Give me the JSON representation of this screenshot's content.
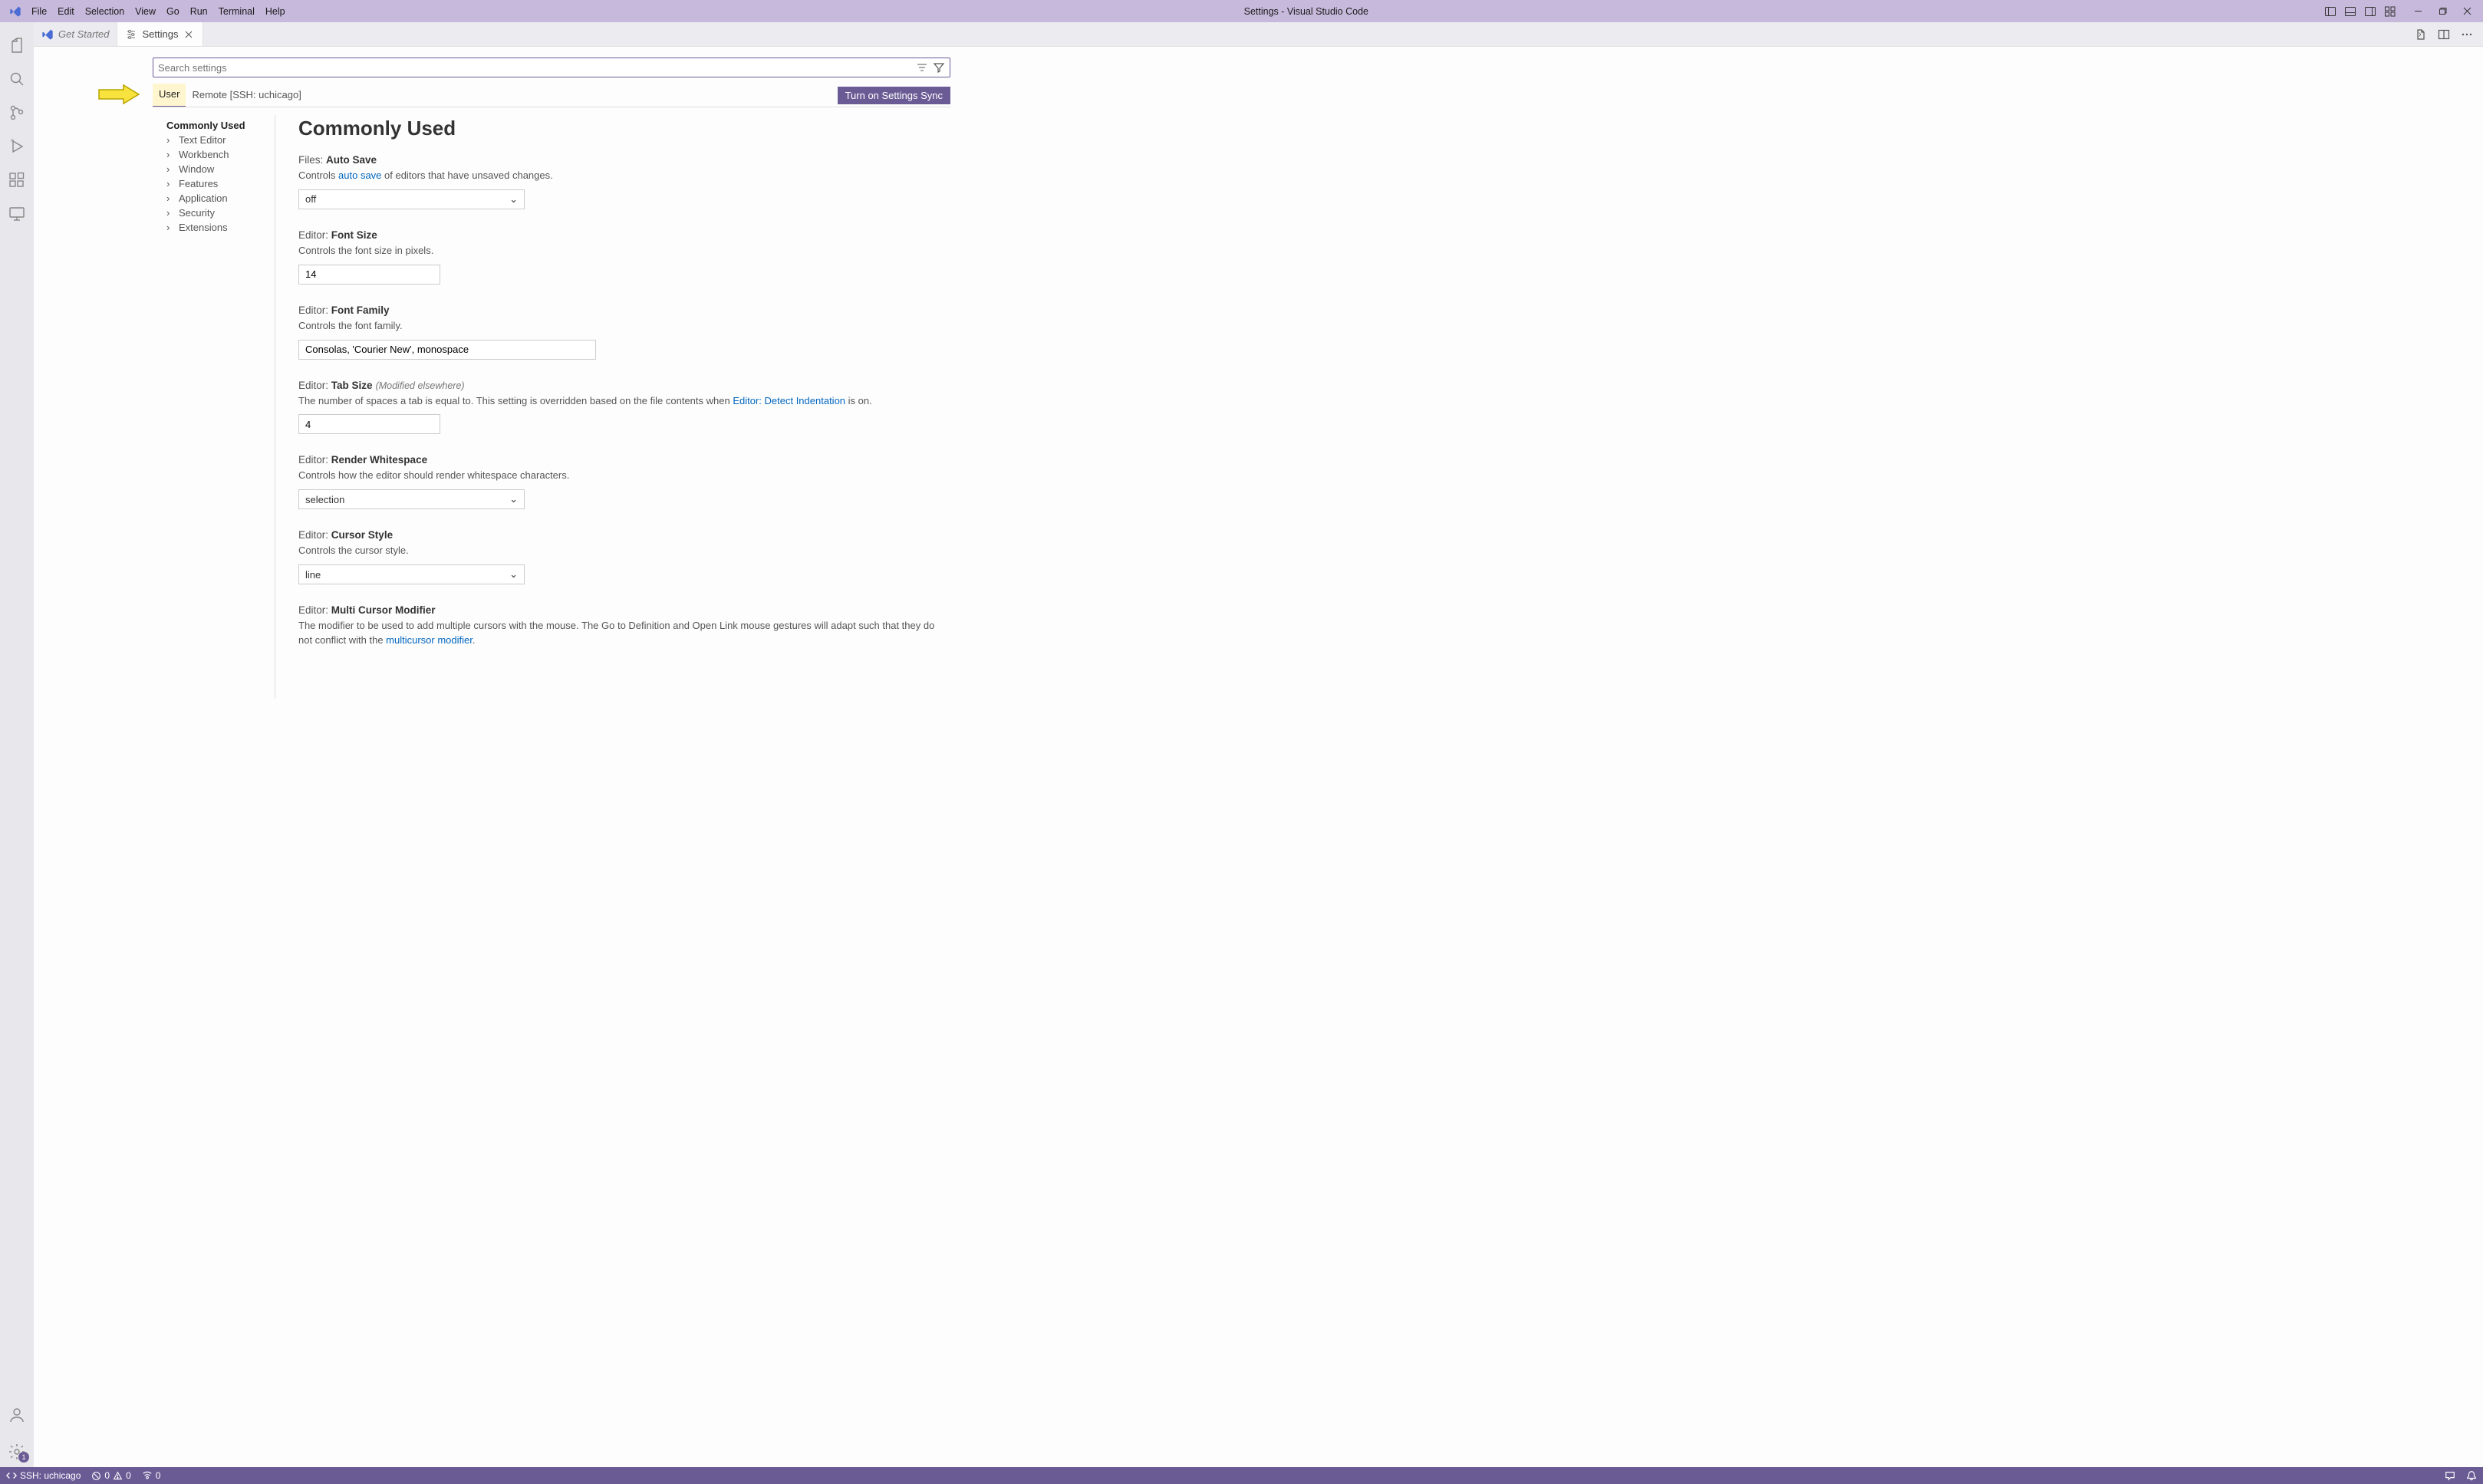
{
  "titlebar": {
    "menus": [
      "File",
      "Edit",
      "Selection",
      "View",
      "Go",
      "Run",
      "Terminal",
      "Help"
    ],
    "title": "Settings - Visual Studio Code"
  },
  "tabs": {
    "getStarted": "Get Started",
    "settings": "Settings"
  },
  "search": {
    "placeholder": "Search settings"
  },
  "scope": {
    "user": "User",
    "remote": "Remote [SSH: uchicago]",
    "syncBtn": "Turn on Settings Sync"
  },
  "toc": {
    "commonly": "Commonly Used",
    "items": [
      "Text Editor",
      "Workbench",
      "Window",
      "Features",
      "Application",
      "Security",
      "Extensions"
    ]
  },
  "heading": "Commonly Used",
  "settings": {
    "autoSave": {
      "prefix": "Files:",
      "name": "Auto Save",
      "desc1": "Controls ",
      "link": "auto save",
      "desc2": " of editors that have unsaved changes.",
      "value": "off"
    },
    "fontSize": {
      "prefix": "Editor:",
      "name": "Font Size",
      "desc": "Controls the font size in pixels.",
      "value": "14"
    },
    "fontFamily": {
      "prefix": "Editor:",
      "name": "Font Family",
      "desc": "Controls the font family.",
      "value": "Consolas, 'Courier New', monospace"
    },
    "tabSize": {
      "prefix": "Editor:",
      "name": "Tab Size",
      "mod": "(Modified elsewhere)",
      "desc1": "The number of spaces a tab is equal to. This setting is overridden based on the file contents when ",
      "link": "Editor: Detect Indentation",
      "desc2": " is on.",
      "value": "4"
    },
    "renderWs": {
      "prefix": "Editor:",
      "name": "Render Whitespace",
      "desc": "Controls how the editor should render whitespace characters.",
      "value": "selection"
    },
    "cursorStyle": {
      "prefix": "Editor:",
      "name": "Cursor Style",
      "desc": "Controls the cursor style.",
      "value": "line"
    },
    "multiCursor": {
      "prefix": "Editor:",
      "name": "Multi Cursor Modifier",
      "desc1": "The modifier to be used to add multiple cursors with the mouse. The Go to Definition and Open Link mouse gestures will adapt such that they do not conflict with the ",
      "link": "multicursor modifier",
      "desc2": "."
    }
  },
  "statusbar": {
    "remote": "SSH: uchicago",
    "errors": "0",
    "warnings": "0",
    "ports": "0"
  },
  "activitybar": {
    "settingsBadge": "1"
  }
}
